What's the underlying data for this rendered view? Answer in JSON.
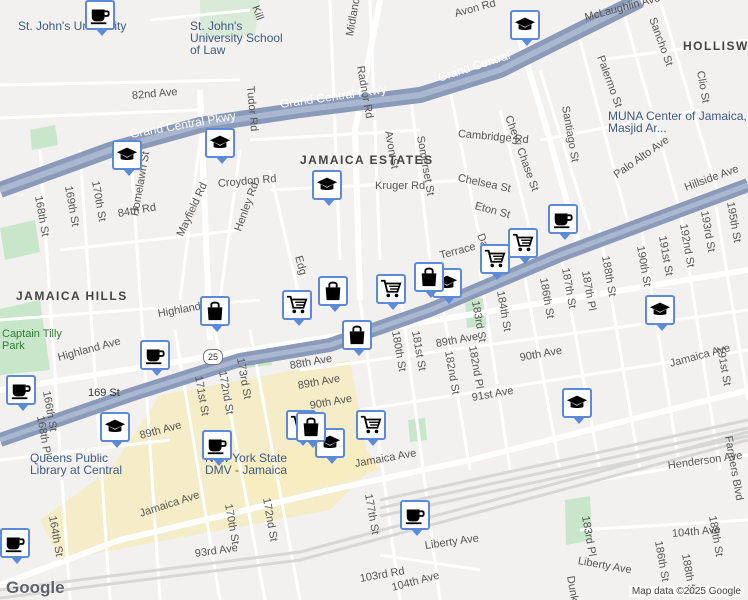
{
  "map": {
    "attribution": "Map data ©2025 Google",
    "logo": "Google",
    "route_shield": "25",
    "neighborhoods": {
      "jamaica_estates": "JAMAICA ESTATES",
      "jamaica_hills": "JAMAICA HILLS",
      "holliswood": "HOLLISWO"
    },
    "highways": {
      "gcp_1": "Grand Central Pkwy",
      "gcp_2": "Grand Central Pkwy",
      "gcp_3": "Grand Central"
    },
    "pois": {
      "st_johns": "St. John's University",
      "school_law": "St. John's University School of Law",
      "muna": "MUNA Center of Jamaica, Masjid Ar...",
      "queens_library": "Queens Public Library at Central",
      "dmv": "New York State DMV - Jamaica",
      "station": "169 St",
      "park": "Captain Tilly Park"
    },
    "streets": {
      "s1": "Avon Rd",
      "s2": "McLaughlin Ave",
      "s3": "Palermo St",
      "s4": "Midland Pkwy",
      "s5": "Radnor Rd",
      "s6": "Tudor Rd",
      "s7": "82nd Ave",
      "s8": "Avon St",
      "s9": "Somerset St",
      "s10": "Cambridge Rd",
      "s11": "Chevy Chase St",
      "s12": "Santiago St",
      "s13": "Croydon Rd",
      "s14": "Kruger Rd",
      "s15": "Chelsea St",
      "s16": "Palo Alto Ave",
      "s17": "Homelawn St",
      "s18": "Mayfield Rd",
      "s19": "Henley Rd",
      "s20": "Eton St",
      "s21": "Hillside Ave",
      "s22": "168th St",
      "s23": "169th St",
      "s24": "170th St",
      "s25": "84th Rd",
      "s26": "Highland Ave",
      "s27": "88th Ave",
      "s28": "89th Ave",
      "s29": "90th Ave",
      "s30": "91st Ave",
      "s31": "Jamaica Ave",
      "s32": "Jamaica Ave",
      "s33": "Henderson Ave",
      "s34": "Liberty Ave",
      "s35": "Liberty Ave",
      "s36": "93rd Ave",
      "s37": "103rd Rd",
      "s38": "104th Ave",
      "s39": "104th Ave",
      "s40": "180th St",
      "s41": "181st St",
      "s42": "182nd St",
      "s43": "182nd Pl",
      "s44": "183rd St",
      "s45": "184th St",
      "s46": "186th St",
      "s47": "187th St",
      "s48": "187th Pl",
      "s49": "188th St",
      "s50": "190th St",
      "s51": "191st St",
      "s52": "192nd St",
      "s53": "193rd St",
      "s54": "195th St",
      "s55": "171st St",
      "s56": "172nd St",
      "s57": "173rd St",
      "s58": "170th St",
      "s59": "172nd St",
      "s60": "177th St",
      "s61": "164th St",
      "s62": "166th St",
      "s63": "168th Pl",
      "s64": "Dunk",
      "s65": "Farmers Blvd",
      "s66": "191st St",
      "s67": "183rd Pl",
      "s68": "186th St",
      "s69": "188th St",
      "s70": "189th St",
      "s71": "Clio St",
      "s72": "Sancho St",
      "s73": "Edg",
      "s74": "Terrace",
      "s75": "89th Ave",
      "s76": "90th Ave",
      "s77": "89th Ave",
      "s78": "Kill",
      "s79": "Da"
    },
    "markers": [
      {
        "icon": "school-icon"
      },
      {
        "icon": "school-icon"
      },
      {
        "icon": "school-icon"
      },
      {
        "icon": "school-icon"
      },
      {
        "icon": "school-icon"
      },
      {
        "icon": "school-icon"
      },
      {
        "icon": "school-icon"
      },
      {
        "icon": "school-icon"
      },
      {
        "icon": "school-icon"
      },
      {
        "icon": "coffee-icon"
      },
      {
        "icon": "coffee-icon"
      },
      {
        "icon": "coffee-icon"
      },
      {
        "icon": "coffee-icon"
      },
      {
        "icon": "coffee-icon"
      },
      {
        "icon": "coffee-icon"
      },
      {
        "icon": "coffee-icon"
      },
      {
        "icon": "cart-icon"
      },
      {
        "icon": "cart-icon"
      },
      {
        "icon": "cart-icon"
      },
      {
        "icon": "cart-icon"
      },
      {
        "icon": "cart-icon"
      },
      {
        "icon": "cart-icon"
      },
      {
        "icon": "bag-icon"
      },
      {
        "icon": "bag-icon"
      },
      {
        "icon": "bag-icon"
      },
      {
        "icon": "bag-icon"
      },
      {
        "icon": "bag-icon"
      }
    ],
    "colors": {
      "highway": "#8a9ab8",
      "road": "#ffffff",
      "park": "#c8e6c9",
      "commercial": "#f5ecc8",
      "pin_border": "#5c8ad8",
      "water_label": "#3d5a80"
    }
  }
}
